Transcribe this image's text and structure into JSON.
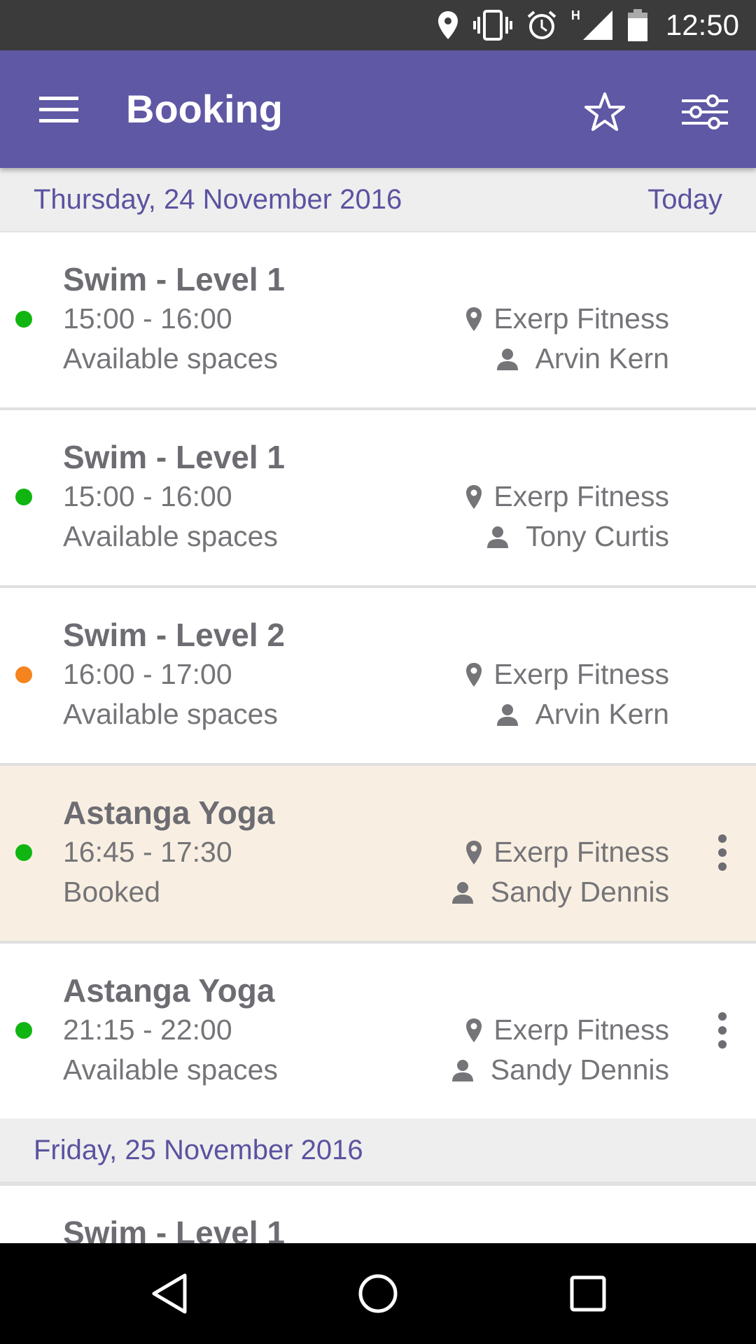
{
  "status_bar": {
    "time": "12:50",
    "icons": [
      "location-icon",
      "vibrate-icon",
      "alarm-icon",
      "signal-icon",
      "battery-icon"
    ],
    "network_label": "H"
  },
  "app_bar": {
    "title": "Booking",
    "color": "#5f58a5",
    "menu_icon": "menu-icon",
    "favorite_icon": "star-icon",
    "filter_icon": "filter-icon"
  },
  "days": [
    {
      "date": "Thursday, 24 November 2016",
      "today_label": "Today",
      "sessions": [
        {
          "title": "Swim - Level 1",
          "time": "15:00 - 16:00",
          "status": "Available spaces",
          "location": "Exerp Fitness",
          "instructor": "Arvin Kern",
          "indicator_color": "#11b511",
          "booked": false,
          "has_menu": false
        },
        {
          "title": "Swim - Level 1",
          "time": "15:00 - 16:00",
          "status": "Available spaces",
          "location": "Exerp Fitness",
          "instructor": "Tony Curtis",
          "indicator_color": "#11b511",
          "booked": false,
          "has_menu": false
        },
        {
          "title": "Swim - Level 2",
          "time": "16:00 - 17:00",
          "status": "Available spaces",
          "location": "Exerp Fitness",
          "instructor": "Arvin Kern",
          "indicator_color": "#f5841f",
          "booked": false,
          "has_menu": false
        },
        {
          "title": "Astanga Yoga",
          "time": "16:45 - 17:30",
          "status": "Booked",
          "location": "Exerp Fitness",
          "instructor": "Sandy Dennis",
          "indicator_color": "#11b511",
          "booked": true,
          "has_menu": true
        },
        {
          "title": "Astanga Yoga",
          "time": "21:15 - 22:00",
          "status": "Available spaces",
          "location": "Exerp Fitness",
          "instructor": "Sandy Dennis",
          "indicator_color": "#11b511",
          "booked": false,
          "has_menu": true
        }
      ]
    },
    {
      "date": "Friday, 25 November 2016",
      "today_label": "",
      "sessions": [
        {
          "title": "Swim - Level 1",
          "time": "",
          "status": "",
          "location": "",
          "instructor": "",
          "indicator_color": "#11b511",
          "booked": false,
          "has_menu": false
        }
      ]
    }
  ],
  "nav_bar": {
    "icons": [
      "back-icon",
      "home-icon",
      "recents-icon"
    ]
  }
}
